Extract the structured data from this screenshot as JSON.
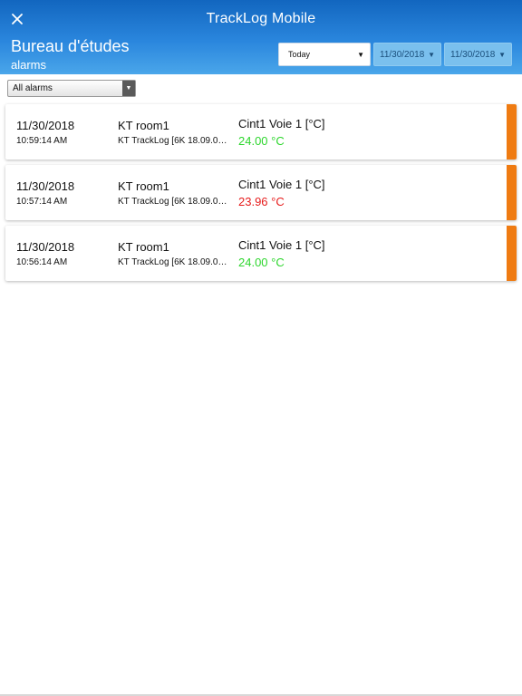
{
  "header": {
    "app_title": "TrackLog Mobile",
    "site_title": "Bureau d'études",
    "site_subtitle": "alarms",
    "period": "Today",
    "date_from": "11/30/2018",
    "date_to": "11/30/2018",
    "close_icon": "close-icon"
  },
  "filter": {
    "selected": "All alarms"
  },
  "colors": {
    "header_top": "#1266bf",
    "header_bottom": "#4aa6ea",
    "alarm_stripe": "#ef7b12",
    "ok_value": "#2ed62e",
    "alarm_value": "#e61b1b"
  },
  "alarms": [
    {
      "date": "11/30/2018",
      "time": "10:59:14 AM",
      "name": "KT room1",
      "device": "KT TrackLog [6K 18.09.0…",
      "channel": "Cint1 Voie 1 [°C]",
      "value": "24.00 °C",
      "status": "ok"
    },
    {
      "date": "11/30/2018",
      "time": "10:57:14 AM",
      "name": "KT room1",
      "device": "KT TrackLog [6K 18.09.0…",
      "channel": "Cint1 Voie 1 [°C]",
      "value": "23.96 °C",
      "status": "alarm"
    },
    {
      "date": "11/30/2018",
      "time": "10:56:14 AM",
      "name": "KT room1",
      "device": "KT TrackLog [6K 18.09.0…",
      "channel": "Cint1 Voie 1 [°C]",
      "value": "24.00 °C",
      "status": "ok"
    }
  ]
}
